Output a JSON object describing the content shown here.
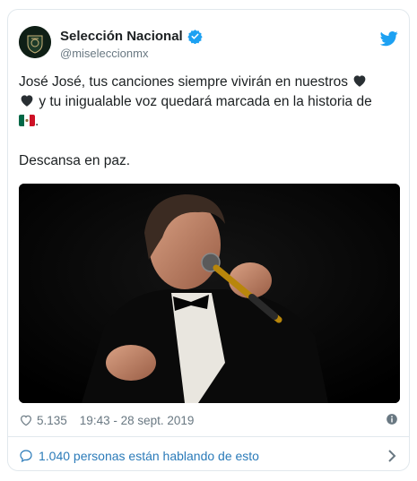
{
  "account": {
    "name": "Selección Nacional",
    "handle": "@miseleccionmx"
  },
  "tweet": {
    "line1": "José José, tus canciones siempre vivirán en nuestros",
    "line2": "y tu inigualable voz quedará marcada en la historia de",
    "line3_end": ".",
    "line4": "Descansa en paz."
  },
  "meta": {
    "likes": "5.135",
    "timestamp": "19:43 - 28 sept. 2019"
  },
  "footer": {
    "talking": "1.040 personas están hablando de esto"
  },
  "colors": {
    "accent": "#1da1f2",
    "link": "#2b7bb9",
    "muted": "#697882"
  },
  "icons": [
    "verified-badge-icon",
    "twitter-bird-icon",
    "black-heart-emoji",
    "mexico-flag-emoji",
    "heart-icon",
    "info-icon",
    "speech-bubble-icon",
    "chevron-right-icon"
  ]
}
